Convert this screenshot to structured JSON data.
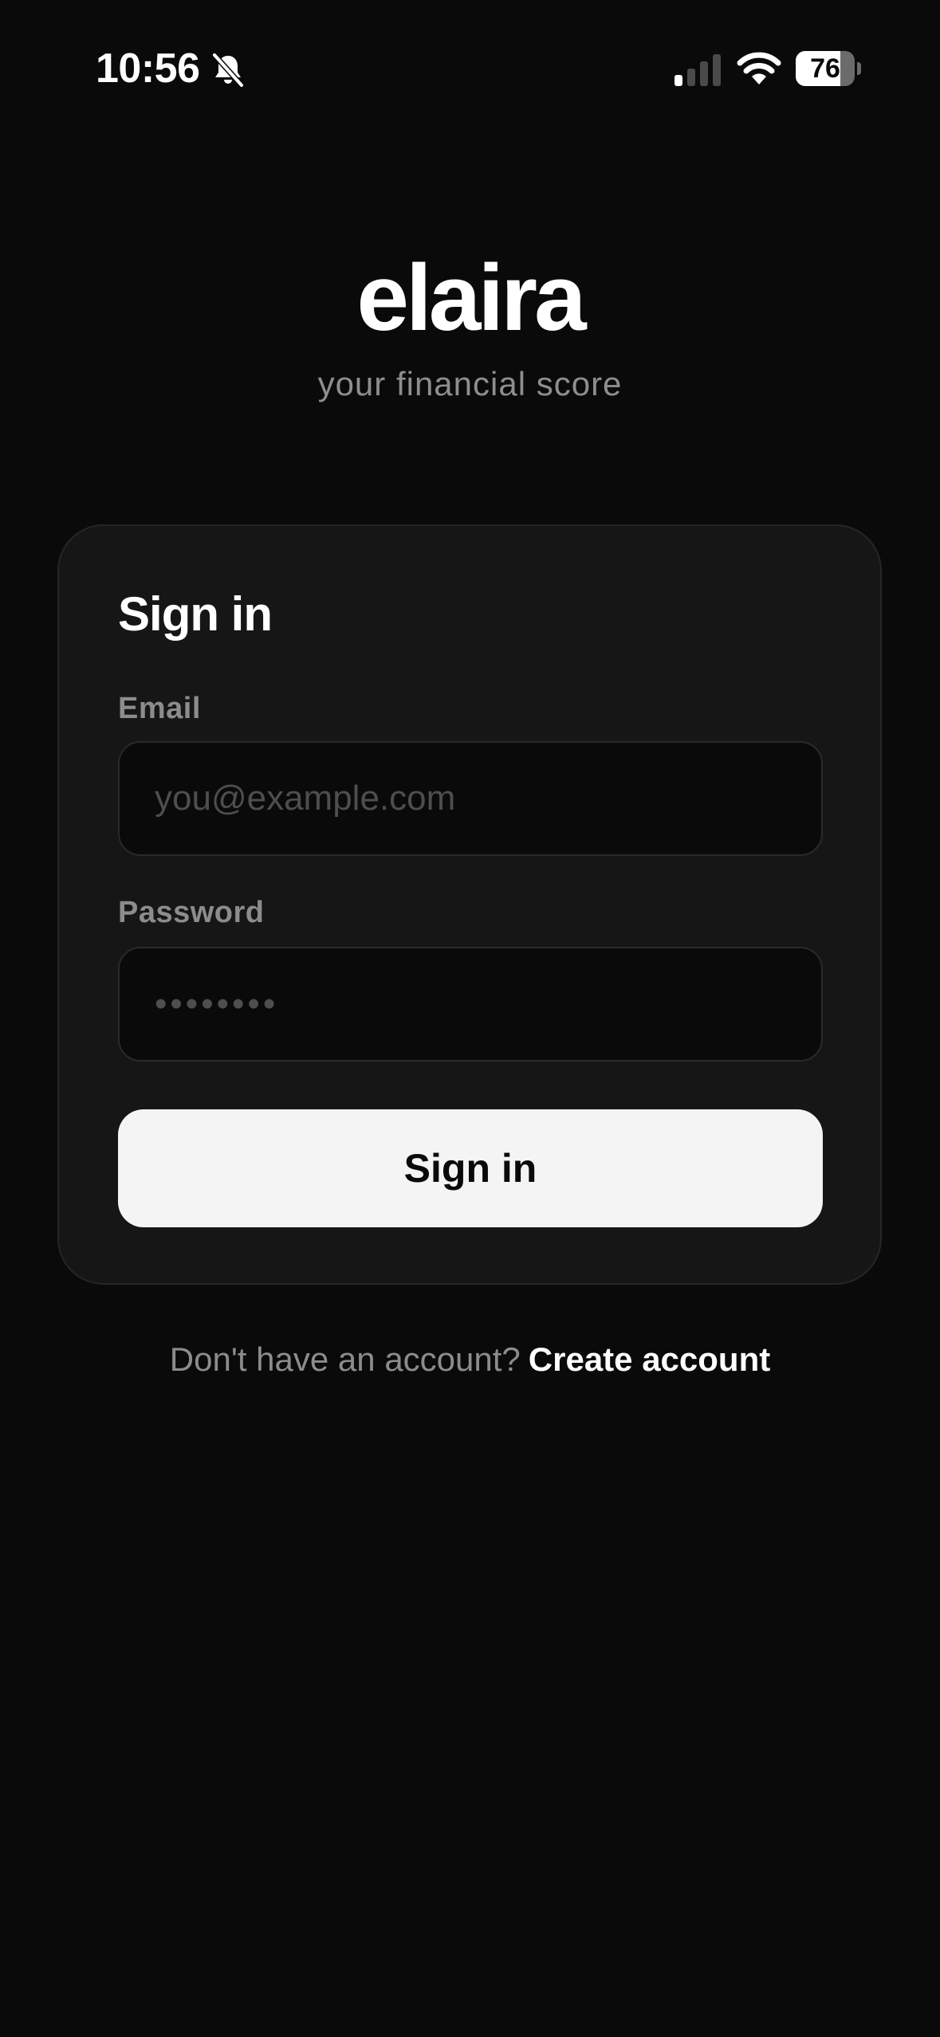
{
  "status_bar": {
    "time": "10:56",
    "battery_level": "76",
    "battery_fraction": 0.76,
    "icons": [
      "bell-slash-icon",
      "cellular-signal-icon",
      "wifi-icon",
      "battery-icon"
    ]
  },
  "brand": {
    "logo": "elaira",
    "tagline": "your financial score"
  },
  "signin_card": {
    "title": "Sign in",
    "email": {
      "label": "Email",
      "placeholder": "you@example.com",
      "value": ""
    },
    "password": {
      "label": "Password",
      "placeholder": "••••••••",
      "value": ""
    },
    "submit_label": "Sign in"
  },
  "footer": {
    "prompt": "Don't have an account?",
    "link_label": "Create account"
  },
  "colors": {
    "background": "#0a0a0a",
    "card": "#161616",
    "card_border": "#262626",
    "button": "#f4f4f4",
    "muted_text": "#8c8c8c"
  }
}
